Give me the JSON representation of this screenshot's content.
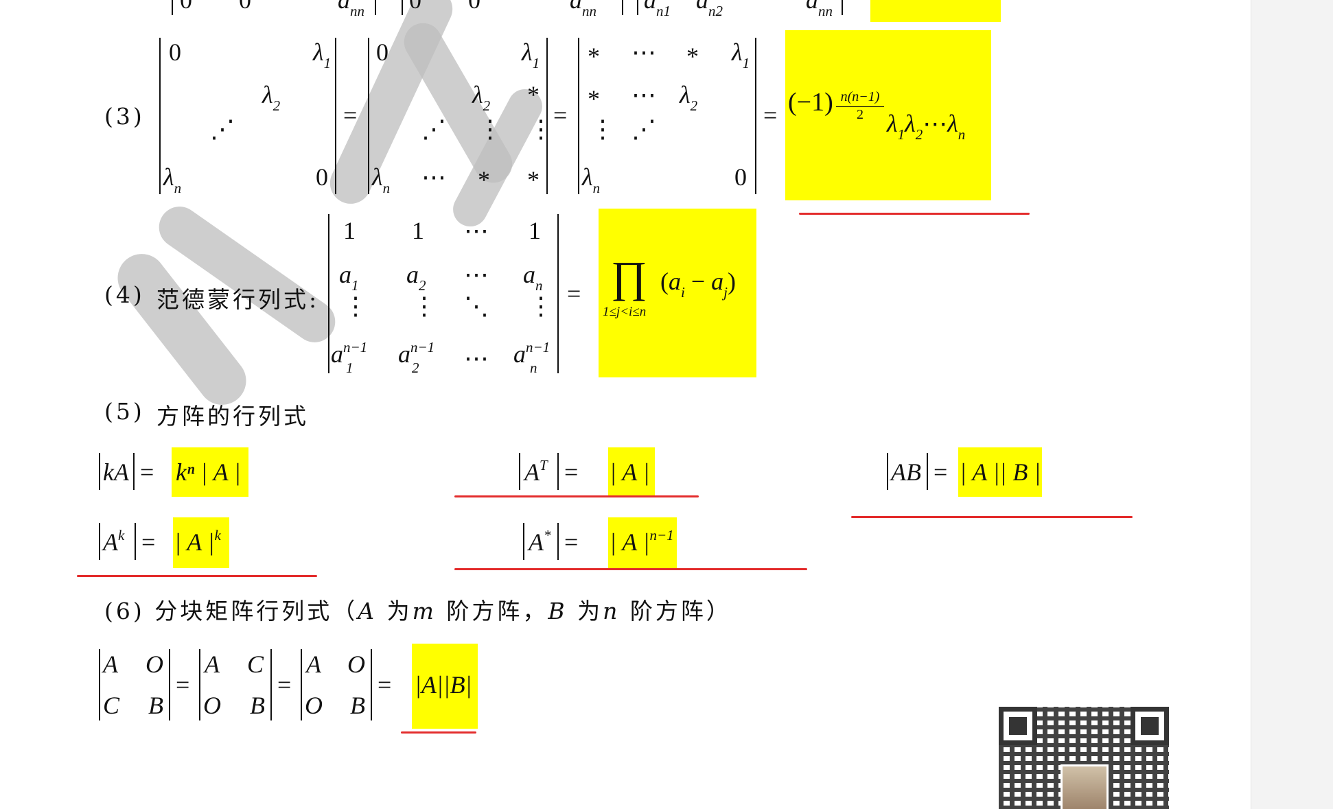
{
  "items": {
    "item3_label": "(3)",
    "item4_label": "(4)",
    "item4_title": "范德蒙行列式:",
    "item5_label": "(5)",
    "item5_title": "方阵的行列式",
    "item6_label": "(6)",
    "item6_title_a": "分块矩阵行列式（",
    "item6_A": "A",
    "item6_is": "为",
    "item6_m": "m",
    "item6_order": "阶方阵，",
    "item6_B": "B",
    "item6_n": "n",
    "item6_end": "阶方阵）"
  },
  "symbols": {
    "zero": "0",
    "one": "1",
    "star": "*",
    "hdots": "⋯",
    "vdots": "⋮",
    "ddots": "⋱",
    "adots": "⋰",
    "equals": "=",
    "lambda": "λ",
    "a": "a",
    "n": "n",
    "n2": "n2",
    "nn": "nn",
    "n1": "n1",
    "sub1": "1",
    "sub2": "2",
    "n_minus_1": "n−1",
    "frac_num": "n(n−1)",
    "frac_den": "2",
    "neg_one": "(−1)",
    "prod": "∏",
    "prod_range": "1≤j<i≤n",
    "ai_minus_aj_open": "(a",
    "ai_minus_aj_mid": "− a",
    "i": "i",
    "j": "j",
    "close_paren": ")",
    "A": "A",
    "B": "B",
    "C": "C",
    "O": "O",
    "k": "k",
    "T": "T",
    "ast": "*"
  },
  "formulas": {
    "kA_lhs": "kA",
    "kA_rhs": "kⁿ | A |",
    "AT_rhs": "| A |",
    "AB_lhs": "AB",
    "AB_rhs": "| A || B |",
    "Ak_rhs_base": "| A |",
    "Astar_rhs_base": "| A |",
    "block_rhs": "|A||B|"
  },
  "colors": {
    "highlight": "#ffff00",
    "underline": "#e32c2c",
    "watermark": "#bdbdbd"
  }
}
